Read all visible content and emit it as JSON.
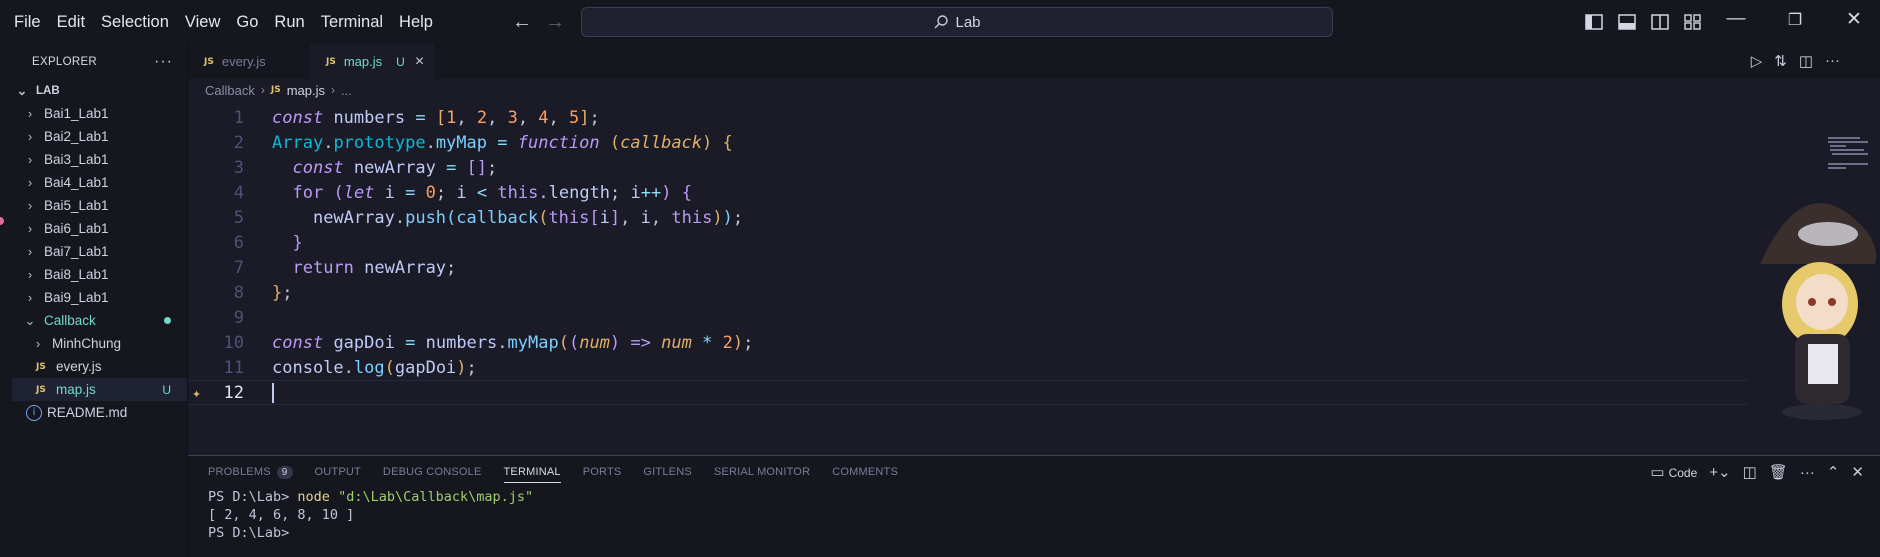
{
  "menu": [
    "File",
    "Edit",
    "Selection",
    "View",
    "Go",
    "Run",
    "Terminal",
    "Help"
  ],
  "search": {
    "label": "Lab"
  },
  "sidebar": {
    "title": "EXPLORER",
    "root": "LAB",
    "items": [
      {
        "label": "Bai1_Lab1",
        "type": "folder"
      },
      {
        "label": "Bai2_Lab1",
        "type": "folder"
      },
      {
        "label": "Bai3_Lab1",
        "type": "folder"
      },
      {
        "label": "Bai4_Lab1",
        "type": "folder"
      },
      {
        "label": "Bai5_Lab1",
        "type": "folder"
      },
      {
        "label": "Bai6_Lab1",
        "type": "folder"
      },
      {
        "label": "Bai7_Lab1",
        "type": "folder"
      },
      {
        "label": "Bai8_Lab1",
        "type": "folder"
      },
      {
        "label": "Bai9_Lab1",
        "type": "folder"
      },
      {
        "label": "Callback",
        "type": "folder-open"
      },
      {
        "label": "MinhChung",
        "type": "folder"
      },
      {
        "label": "every.js",
        "type": "js"
      },
      {
        "label": "map.js",
        "type": "js",
        "status": "U"
      },
      {
        "label": "README.md",
        "type": "info"
      }
    ]
  },
  "tabs": [
    {
      "label": "every.js",
      "icon": "JS"
    },
    {
      "label": "map.js",
      "icon": "JS",
      "status": "U"
    }
  ],
  "breadcrumb": {
    "folder": "Callback",
    "file": "map.js",
    "more": "..."
  },
  "code": {
    "line_numbers": [
      "1",
      "2",
      "3",
      "4",
      "5",
      "6",
      "7",
      "8",
      "9",
      "10",
      "11",
      "12"
    ],
    "lines": [
      "const numbers = [1, 2, 3, 4, 5];",
      "Array.prototype.myMap = function (callback) {",
      "  const newArray = [];",
      "  for (let i = 0; i < this.length; i++) {",
      "    newArray.push(callback(this[i], i, this));",
      "  }",
      "  return newArray;",
      "};",
      "",
      "const gapDoi = numbers.myMap((num) => num * 2);",
      "console.log(gapDoi);",
      ""
    ]
  },
  "panel": {
    "tabs": [
      "PROBLEMS",
      "OUTPUT",
      "DEBUG CONSOLE",
      "TERMINAL",
      "PORTS",
      "GITLENS",
      "SERIAL MONITOR",
      "COMMENTS"
    ],
    "problems_count": "9",
    "terminal_profile": "Code",
    "terminal_lines": {
      "prompt1": "PS D:\\Lab>",
      "cmd": "node",
      "arg": "\"d:\\Lab\\Callback\\map.js\"",
      "output": "[ 2, 4, 6, 8, 10 ]",
      "prompt2": "PS D:\\Lab>"
    }
  },
  "colors": {
    "accent": "#73daca",
    "keyword": "#bb9af7",
    "number": "#ff9e64",
    "function": "#7dcfff"
  }
}
